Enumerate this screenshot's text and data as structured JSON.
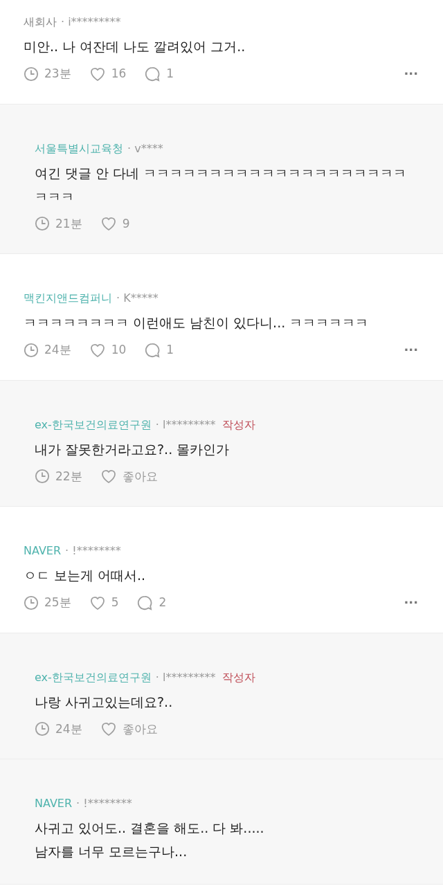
{
  "comments": [
    {
      "kind": "comment",
      "company": "새회사",
      "color": "#8a8a8a",
      "user": "· i*********",
      "text": "미안.. 나 여잔데 나도 깔려있어 그거..",
      "time": "23분",
      "likes": "16",
      "replies": "1",
      "menu": "···"
    },
    {
      "kind": "reply",
      "company": "서울특별시교육청",
      "color": "#4fb3ad",
      "user": "· v****",
      "text": "여긴 댓글 안 다네 ㅋㅋㅋㅋㅋㅋㅋㅋㅋㅋㅋㅋㅋㅋㅋㅋㅋㅋㅋㅋㅋㅋㅋ",
      "time": "21분",
      "likes": "9"
    },
    {
      "kind": "comment",
      "company": "맥킨지앤드컴퍼니",
      "color": "#4fb3ad",
      "user": "· K*****",
      "text": "ㅋㅋㅋㅋㅋㅋㅋㅋ 이런애도 남친이 있다니... ㅋㅋㅋㅋㅋㅋ",
      "time": "24분",
      "likes": "10",
      "replies": "1",
      "menu": "···"
    },
    {
      "kind": "reply",
      "company": "ex-한국보건의료연구원",
      "color": "#4fb3ad",
      "user": "· l*********",
      "author_label": "작성자",
      "text": "내가 잘못한거라고요?.. 몰카인가",
      "time": "22분",
      "likes": "좋아요"
    },
    {
      "kind": "comment",
      "company": "NAVER",
      "color": "#4fb3ad",
      "user": "· !********",
      "text": "ㅇㄷ 보는게 어때서..",
      "time": "25분",
      "likes": "5",
      "replies": "2",
      "menu": "···"
    },
    {
      "kind": "reply",
      "company": "ex-한국보건의료연구원",
      "color": "#4fb3ad",
      "user": "· l*********",
      "author_label": "작성자",
      "text": "나랑 사귀고있는데요?..",
      "time": "24분",
      "likes": "좋아요"
    },
    {
      "kind": "reply",
      "company": "NAVER",
      "color": "#4fb3ad",
      "user": "· !********",
      "text": "사귀고 있어도.. 결혼을 해도.. 다 봐.....\n남자를 너무 모르는구나..."
    }
  ]
}
